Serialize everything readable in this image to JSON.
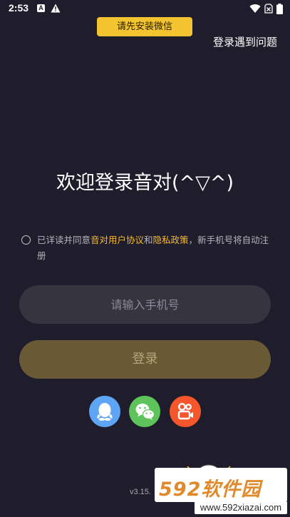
{
  "status_bar": {
    "time": "2:53",
    "notification_letter": "A",
    "icons": [
      "notification-a-icon",
      "warning-icon",
      "wifi-icon",
      "no-sim-icon",
      "battery-icon"
    ]
  },
  "banner": {
    "text": "请先安装微信"
  },
  "header": {
    "help_link": "登录遇到问题"
  },
  "main": {
    "title": "欢迎登录音对(^▽^)",
    "agreement": {
      "prefix": "已详读并同意",
      "link_user_agreement": "音对用户协议",
      "connector": "和",
      "link_privacy": "隐私政策",
      "suffix": "，新手机号将自动注册"
    },
    "phone_input": {
      "placeholder": "请输入手机号",
      "value": ""
    },
    "login_button": "登录"
  },
  "social_login": [
    {
      "name": "qq",
      "icon": "qq-icon",
      "color": "#5fa5f5"
    },
    {
      "name": "wechat",
      "icon": "wechat-icon",
      "color": "#5dc35a"
    },
    {
      "name": "kuaishou",
      "icon": "kuaishou-icon",
      "color": "#f5562c"
    }
  ],
  "footer": {
    "version": "v3.15."
  },
  "watermark": {
    "brand": "592软件园",
    "url": "www.592xiazai.com"
  },
  "colors": {
    "background": "#1f1d2b",
    "banner": "#f4c430",
    "link": "#f2b93b",
    "input_bg": "#36343f",
    "button_bg": "#695a36",
    "button_text": "#b6a67a"
  }
}
